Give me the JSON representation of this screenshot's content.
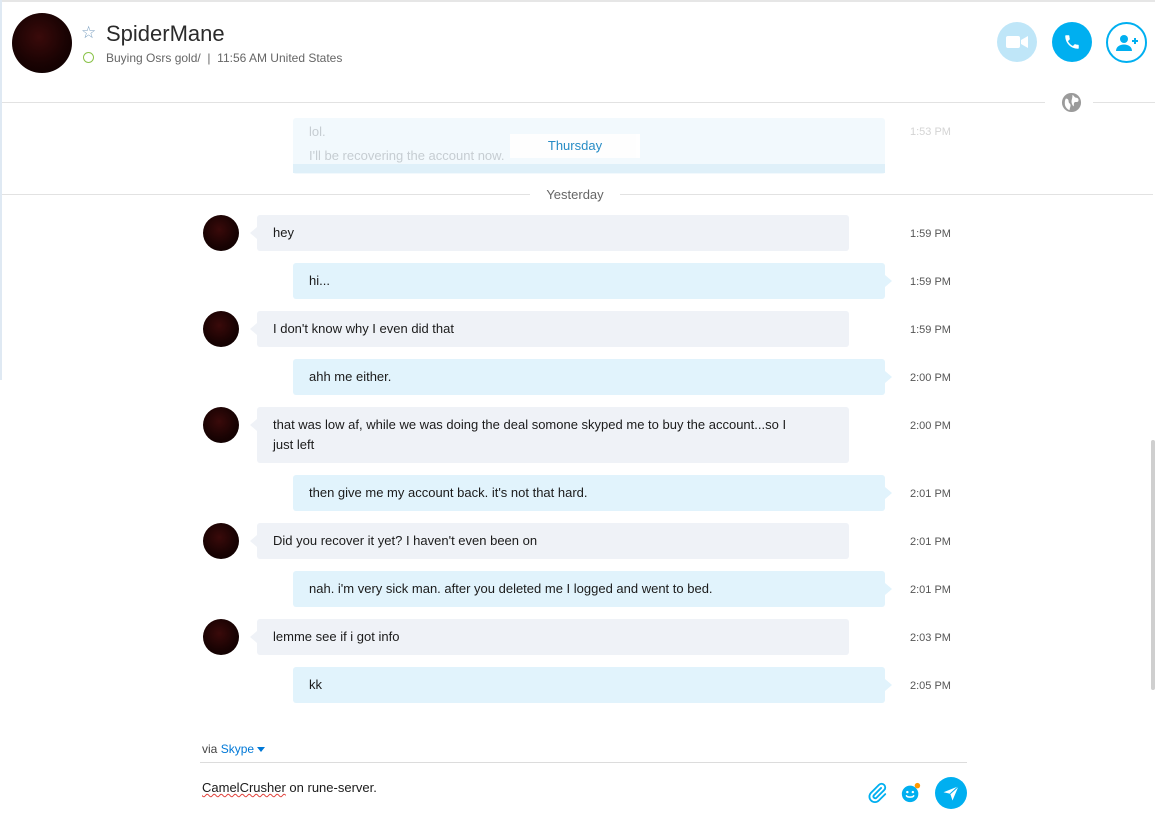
{
  "contact": {
    "name": "SpiderMane",
    "mood_status": "Buying Osrs gold/  |  11:56 AM United States"
  },
  "header_buttons": {
    "video_icon": "video-camera-icon",
    "call_icon": "phone-icon",
    "add_icon": "add-contact-icon"
  },
  "earlier": {
    "day_label": "Thursday",
    "faded_line_1": "lol.",
    "faded_line_2": "I'll be recovering the account now.",
    "faded_time": "1:53 PM"
  },
  "separator": {
    "label": "Yesterday"
  },
  "messages": [
    {
      "from": "them",
      "text": "hey",
      "time": "1:59 PM"
    },
    {
      "from": "me",
      "text": "hi...",
      "time": "1:59 PM"
    },
    {
      "from": "them",
      "text": "I don't know why I even did that",
      "time": "1:59 PM"
    },
    {
      "from": "me",
      "text": "ahh me either.",
      "time": "2:00 PM"
    },
    {
      "from": "them",
      "text": "that was low af, while we was doing the deal somone skyped me to buy the account...so I just left",
      "time": "2:00 PM"
    },
    {
      "from": "me",
      "text": "then give me my account back. it's not that hard.",
      "time": "2:01 PM"
    },
    {
      "from": "them",
      "text": "Did you recover it yet? I haven't even been on",
      "time": "2:01 PM"
    },
    {
      "from": "me",
      "text": "nah. i'm very sick man. after you deleted me I logged and went to bed.",
      "time": "2:01 PM"
    },
    {
      "from": "them",
      "text": "lemme see if i got info",
      "time": "2:03 PM"
    },
    {
      "from": "me",
      "text": "kk",
      "time": "2:05 PM"
    }
  ],
  "composer": {
    "via_label": "via",
    "via_service": "Skype",
    "draft_misspelled": "CamelCrusher",
    "draft_rest": " on rune-server."
  },
  "colors": {
    "accent": "#00aff0",
    "incoming_bubble": "#eff2f7",
    "outgoing_bubble": "#e1f3fc"
  }
}
